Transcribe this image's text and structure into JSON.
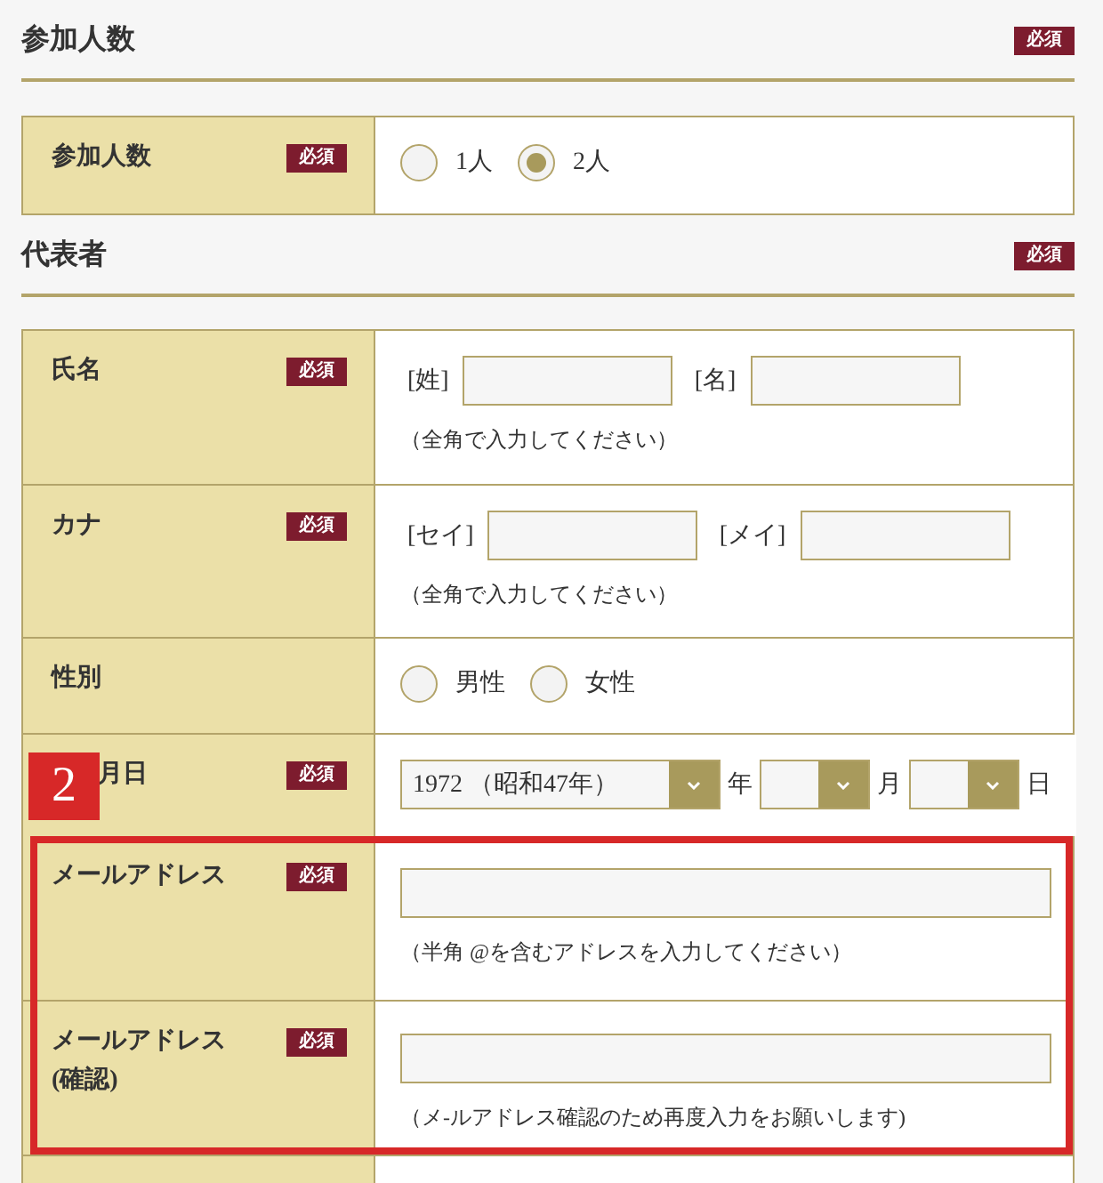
{
  "sections": [
    {
      "title": "参加人数",
      "badge": "必須",
      "rows": [
        {
          "kind": "radio",
          "label": "参加人数",
          "badge": "必須",
          "options": [
            {
              "label": "1人",
              "selected": false
            },
            {
              "label": "2人",
              "selected": true
            }
          ]
        }
      ]
    },
    {
      "title": "代表者",
      "badge": "必須",
      "rows": [
        {
          "kind": "pair",
          "label": "氏名",
          "badge": "必須",
          "fields": [
            {
              "prefix": "[姓]"
            },
            {
              "prefix": "[名]"
            }
          ],
          "note": "（全角で入力してください）"
        },
        {
          "kind": "pair",
          "label": "カナ",
          "badge": "必須",
          "fields": [
            {
              "prefix": "[セイ]"
            },
            {
              "prefix": "[メイ]"
            }
          ],
          "note": "（全角で入力してください）"
        },
        {
          "kind": "radio",
          "label": "性別",
          "options": [
            {
              "label": "男性",
              "selected": false
            },
            {
              "label": "女性",
              "selected": false
            }
          ]
        },
        {
          "kind": "date",
          "label": "月日",
          "badge": "必須",
          "callout": "2",
          "selects": [
            {
              "value": "1972 （昭和47年）",
              "unit": "年"
            },
            {
              "unit": "月"
            },
            {
              "unit": "日"
            }
          ]
        },
        {
          "kind": "email",
          "label": "メールアドレス",
          "badge": "必須",
          "note": "（半角 @を含むアドレスを入力してください）",
          "highlighted": true
        },
        {
          "kind": "email",
          "label": "メールアドレス",
          "sublabel": "(確認)",
          "badge": "必須",
          "note": "（メ-ルアドレス確認のため再度入力をお願いします)",
          "highlighted": true
        },
        {
          "kind": "empty"
        }
      ]
    }
  ]
}
